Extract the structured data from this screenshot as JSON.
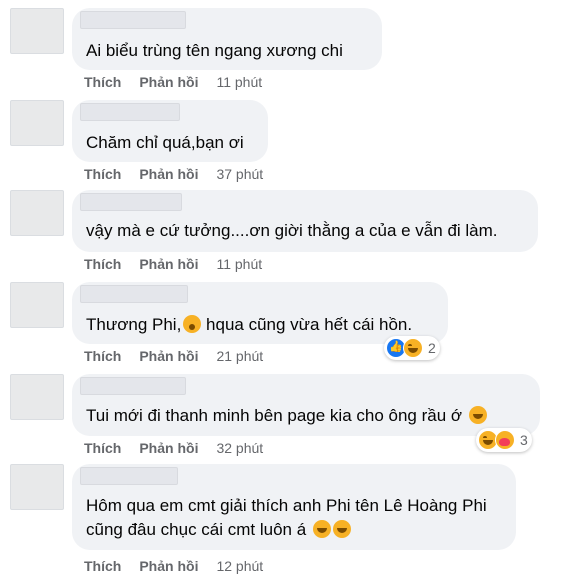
{
  "comments": [
    {
      "text": "Ai biểu trùng tên ngang xương chi",
      "like": "Thích",
      "reply": "Phản hồi",
      "time": "11 phút"
    },
    {
      "text": "Chăm chỉ quá,bạn ơi",
      "like": "Thích",
      "reply": "Phản hồi",
      "time": "37 phút"
    },
    {
      "text": "vậy mà e cứ tưởng....ơn giời thằng a của e vẫn đi làm.",
      "like": "Thích",
      "reply": "Phản hồi",
      "time": "11 phút"
    },
    {
      "text": "Thương Phi,",
      "text_after": "hqua cũng vừa hết cái hồn.",
      "like": "Thích",
      "reply": "Phản hồi",
      "time": "21 phút",
      "reactions": {
        "icons": [
          "like-icon",
          "haha-icon"
        ],
        "count": "2"
      }
    },
    {
      "text": "Tui mới đi thanh minh bên page kia cho ông rầu ớ",
      "like": "Thích",
      "reply": "Phản hồi",
      "time": "32 phút",
      "reactions": {
        "icons": [
          "haha-icon",
          "care-icon"
        ],
        "count": "3"
      }
    },
    {
      "text": "Hôm qua em cmt giải thích anh Phi tên Lê Hoàng Phi",
      "text_line2": "cũng đâu chục cái cmt luôn á",
      "like": "Thích",
      "reply": "Phản hồi",
      "time": "12 phút"
    }
  ],
  "colors": {
    "bubble": "#f0f2f5",
    "meta": "#65676b",
    "like_blue": "#1877f2",
    "haha": "#f7b125"
  }
}
